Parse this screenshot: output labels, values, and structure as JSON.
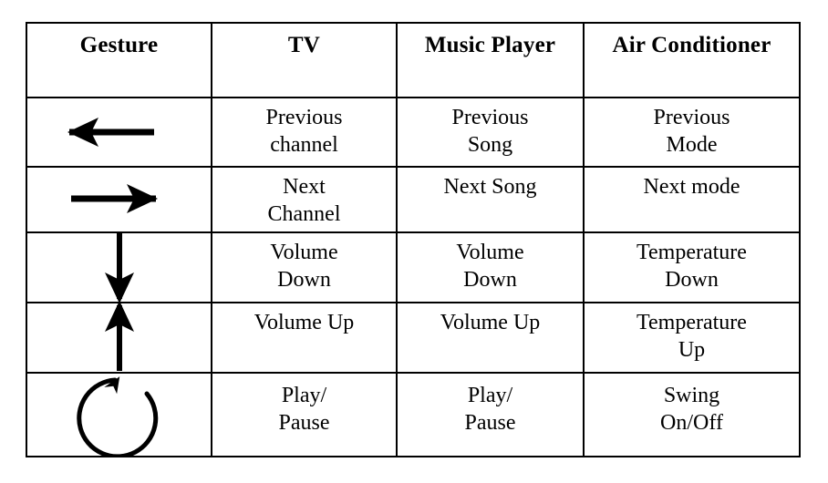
{
  "table": {
    "columns": [
      {
        "key": "gesture",
        "label": "Gesture"
      },
      {
        "key": "tv",
        "label": "TV"
      },
      {
        "key": "music",
        "label": "Music\nPlayer"
      },
      {
        "key": "ac",
        "label": "Air\nConditioner"
      }
    ],
    "rows": [
      {
        "gesture_icon": "arrow-left-icon",
        "gesture_name": "swipe-left",
        "tv": "Previous\nchannel",
        "music": "Previous\nSong",
        "ac": "Previous\nMode"
      },
      {
        "gesture_icon": "arrow-right-icon",
        "gesture_name": "swipe-right",
        "tv": "Next\nChannel",
        "music": "Next Song",
        "ac": "Next mode"
      },
      {
        "gesture_icon": "arrow-down-icon",
        "gesture_name": "swipe-down",
        "tv": "Volume\nDown",
        "music": "Volume\nDown",
        "ac": "Temperature\nDown"
      },
      {
        "gesture_icon": "arrow-up-icon",
        "gesture_name": "swipe-up",
        "tv": "Volume Up",
        "music": "Volume Up",
        "ac": "Temperature\nUp"
      },
      {
        "gesture_icon": "circle-clockwise-icon",
        "gesture_name": "draw-circle",
        "tv": "Play/\nPause",
        "music": "Play/\nPause",
        "ac": "Swing\nOn/Off"
      }
    ]
  },
  "colors": {
    "ink": "#000000",
    "paper": "#ffffff",
    "border": "#000000"
  }
}
